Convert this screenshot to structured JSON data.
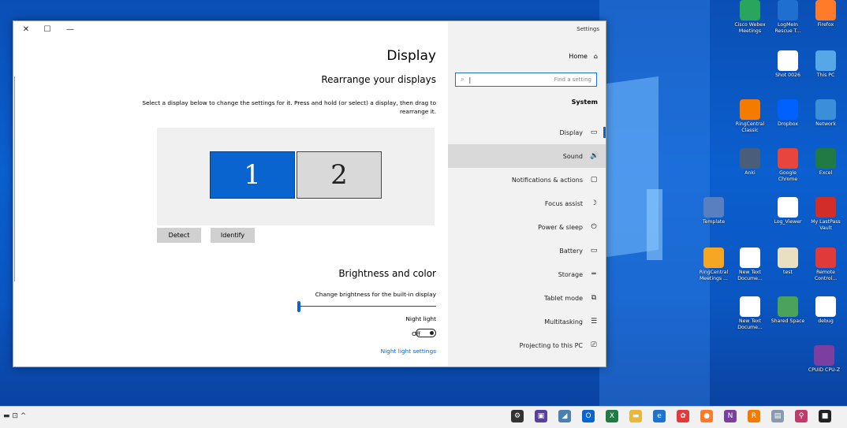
{
  "window": {
    "app_title": "Settings",
    "controls": {
      "close": "✕",
      "maximize": "☐",
      "minimize": "—"
    }
  },
  "nav": {
    "home_label": "Home",
    "search_placeholder": "Find a setting",
    "section": "System",
    "items": [
      {
        "label": "Display",
        "icon": "monitor-icon",
        "glyph": "▭"
      },
      {
        "label": "Sound",
        "icon": "speaker-icon",
        "glyph": "🔊"
      },
      {
        "label": "Notifications & actions",
        "icon": "message-icon",
        "glyph": "▢"
      },
      {
        "label": "Focus assist",
        "icon": "moon-icon",
        "glyph": "☽"
      },
      {
        "label": "Power & sleep",
        "icon": "power-icon",
        "glyph": "⏻"
      },
      {
        "label": "Battery",
        "icon": "battery-icon",
        "glyph": "▭"
      },
      {
        "label": "Storage",
        "icon": "storage-icon",
        "glyph": "═"
      },
      {
        "label": "Tablet mode",
        "icon": "tablet-icon",
        "glyph": "⧉"
      },
      {
        "label": "Multitasking",
        "icon": "multitask-icon",
        "glyph": "☰"
      },
      {
        "label": "Projecting to this PC",
        "icon": "project-icon",
        "glyph": "⎚"
      }
    ]
  },
  "main": {
    "title": "Display",
    "rearrange_heading": "Rearrange your displays",
    "rearrange_desc": "Select a display below to change the settings for it. Press and hold (or select) a display, then drag to rearrange it.",
    "monitor1": "1",
    "monitor2": "2",
    "detect_label": "Detect",
    "identify_label": "Identify",
    "brightness_heading": "Brightness and color",
    "brightness_label": "Change brightness for the built-in display",
    "brightness_value": 0,
    "night_light_label": "Night light",
    "night_light_state": "Off",
    "night_light_link": "Night light settings"
  },
  "desktop": {
    "icons": [
      {
        "label": "Cisco Webex Meetings",
        "color": "#2aa55e"
      },
      {
        "label": "LogMeIn Rescue T...",
        "color": "#1e6fd0"
      },
      {
        "label": "Firefox",
        "color": "#ff7b2a"
      },
      {
        "label": "Shot 0026",
        "color": "#ffffff"
      },
      {
        "label": "This PC",
        "color": "#56a7e8"
      },
      {
        "label": "RingCentral Classic",
        "color": "#f57a00"
      },
      {
        "label": "Dropbox",
        "color": "#0061fe"
      },
      {
        "label": "Network",
        "color": "#3a8fd8"
      },
      {
        "label": "Anki",
        "color": "#4a5e7a"
      },
      {
        "label": "Google Chrome",
        "color": "#e8453c"
      },
      {
        "label": "Excel",
        "color": "#1f7a43"
      },
      {
        "label": "Template",
        "color": "#5a7fc0"
      },
      {
        "label": "Log_Viewer",
        "color": "#ffffff"
      },
      {
        "label": "My LastPass Vault",
        "color": "#d32d27"
      },
      {
        "label": "RingCentral Meetings ...",
        "color": "#f5a623"
      },
      {
        "label": "New Text Docume...",
        "color": "#ffffff"
      },
      {
        "label": "test",
        "color": "#e8e0c0"
      },
      {
        "label": "Remote Control...",
        "color": "#e03a3a"
      },
      {
        "label": "New Text Docume...",
        "color": "#ffffff"
      },
      {
        "label": "Shared Space",
        "color": "#4aa35a"
      },
      {
        "label": "debug",
        "color": "#ffffff"
      },
      {
        "label": "CPUID CPU-Z",
        "color": "#7a3fa0"
      }
    ]
  },
  "taskbar": {
    "left_glyphs": "▬ ⊡ ^",
    "apps": [
      {
        "name": "gear-icon",
        "glyph": "⚙",
        "color": "#333333"
      },
      {
        "name": "app-icon",
        "glyph": "▣",
        "color": "#5a3fa0"
      },
      {
        "name": "app-icon",
        "glyph": "◢",
        "color": "#4a7fb0"
      },
      {
        "name": "outlook-icon",
        "glyph": "O",
        "color": "#0a64d0"
      },
      {
        "name": "excel-icon",
        "glyph": "X",
        "color": "#1f7a43"
      },
      {
        "name": "folder-icon",
        "glyph": "▬",
        "color": "#e8b83a"
      },
      {
        "name": "edge-icon",
        "glyph": "e",
        "color": "#1e73d2"
      },
      {
        "name": "app-icon",
        "glyph": "✿",
        "color": "#e03a3a"
      },
      {
        "name": "firefox-icon",
        "glyph": "●",
        "color": "#ff7b2a"
      },
      {
        "name": "onenote-icon",
        "glyph": "N",
        "color": "#7a3fa0"
      },
      {
        "name": "ringcentral-icon",
        "glyph": "R",
        "color": "#f57a00"
      },
      {
        "name": "app-icon",
        "glyph": "▤",
        "color": "#8a9ab0"
      },
      {
        "name": "network-icon",
        "glyph": "⚲",
        "color": "#c03a6a"
      },
      {
        "name": "windows-icon",
        "glyph": "■",
        "color": "#222222"
      }
    ]
  }
}
